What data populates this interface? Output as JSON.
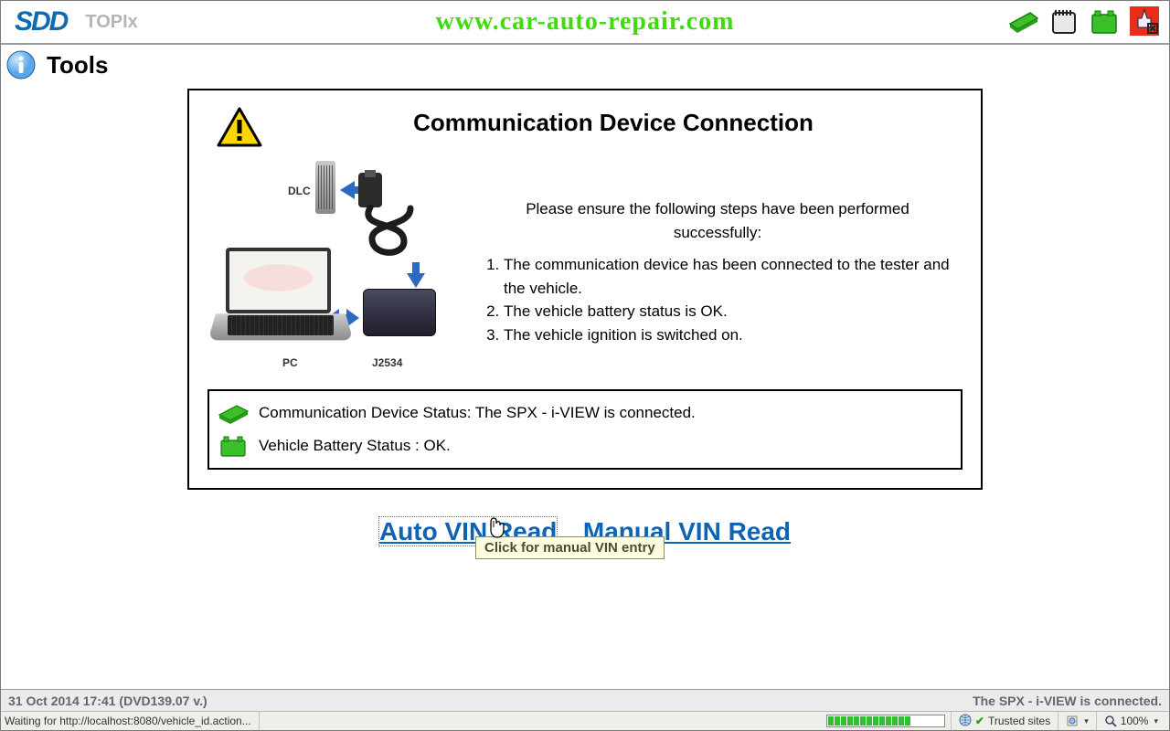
{
  "header": {
    "logo": "SDD",
    "topix": "TOPIx",
    "watermark": "www.car-auto-repair.com"
  },
  "page": {
    "section": "Tools"
  },
  "panel": {
    "title": "Communication Device Connection",
    "intro": "Please ensure the following steps have been performed successfully:",
    "steps": [
      "The communication device has been connected to the tester and the vehicle.",
      "The vehicle battery status is OK.",
      "The vehicle ignition is switched on."
    ],
    "diagram_labels": {
      "dlc": "DLC",
      "pc": "PC",
      "j2534": "J2534"
    }
  },
  "status": {
    "device": "Communication Device Status: The SPX - i-VIEW is connected.",
    "battery": "Vehicle Battery Status : OK."
  },
  "actions": {
    "auto_vin": "Auto VIN Read",
    "manual_vin": "Manual VIN Read"
  },
  "tooltip": "Click for manual VIN entry",
  "app_status": {
    "left": "31 Oct 2014 17:41 (DVD139.07 v.)",
    "right": "The SPX - i-VIEW is connected."
  },
  "browser_status": {
    "waiting": "Waiting for http://localhost:8080/vehicle_id.action...",
    "zone": "Trusted sites",
    "zoom": "100%"
  }
}
